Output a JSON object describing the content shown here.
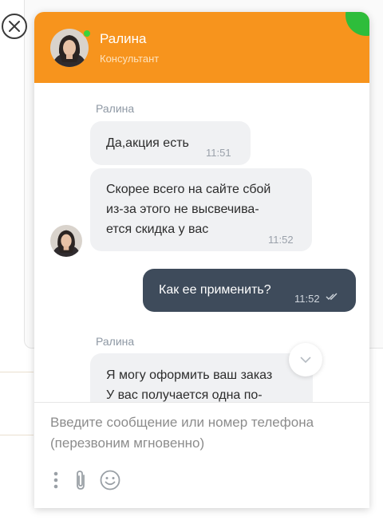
{
  "header": {
    "agent_name": "Ралина",
    "agent_role": "Консультант"
  },
  "messages": [
    {
      "sender": "Ралина",
      "text_lines": [
        "Да,акция есть"
      ],
      "time": "11:51",
      "direction": "in"
    },
    {
      "text_lines": [
        "Скорее всего на сайте сбой",
        "из-за этого не высвечива-",
        "ется скидка у вас"
      ],
      "time": "11:52",
      "direction": "in"
    },
    {
      "text_lines": [
        "Как ее применить?"
      ],
      "time": "11:52",
      "direction": "out",
      "status": "read-double-check-icon"
    },
    {
      "sender": "Ралина",
      "text_lines": [
        "Я могу оформить ваш заказ",
        "У вас получается одна по-"
      ],
      "direction": "in"
    }
  ],
  "input": {
    "placeholder": "Введите сообщение или номер телефона (перезвоним мгновенно)"
  },
  "icons": {
    "close": "close-icon",
    "more": "more-vertical-icon",
    "attach": "paperclip-icon",
    "emoji": "emoji-icon",
    "scroll": "chevron-down-icon"
  },
  "colors": {
    "header": "#f7941d",
    "accent_corner": "#2ebd3b",
    "outgoing_bubble": "#3e4b5b",
    "incoming_bubble": "#f0f1f3"
  }
}
